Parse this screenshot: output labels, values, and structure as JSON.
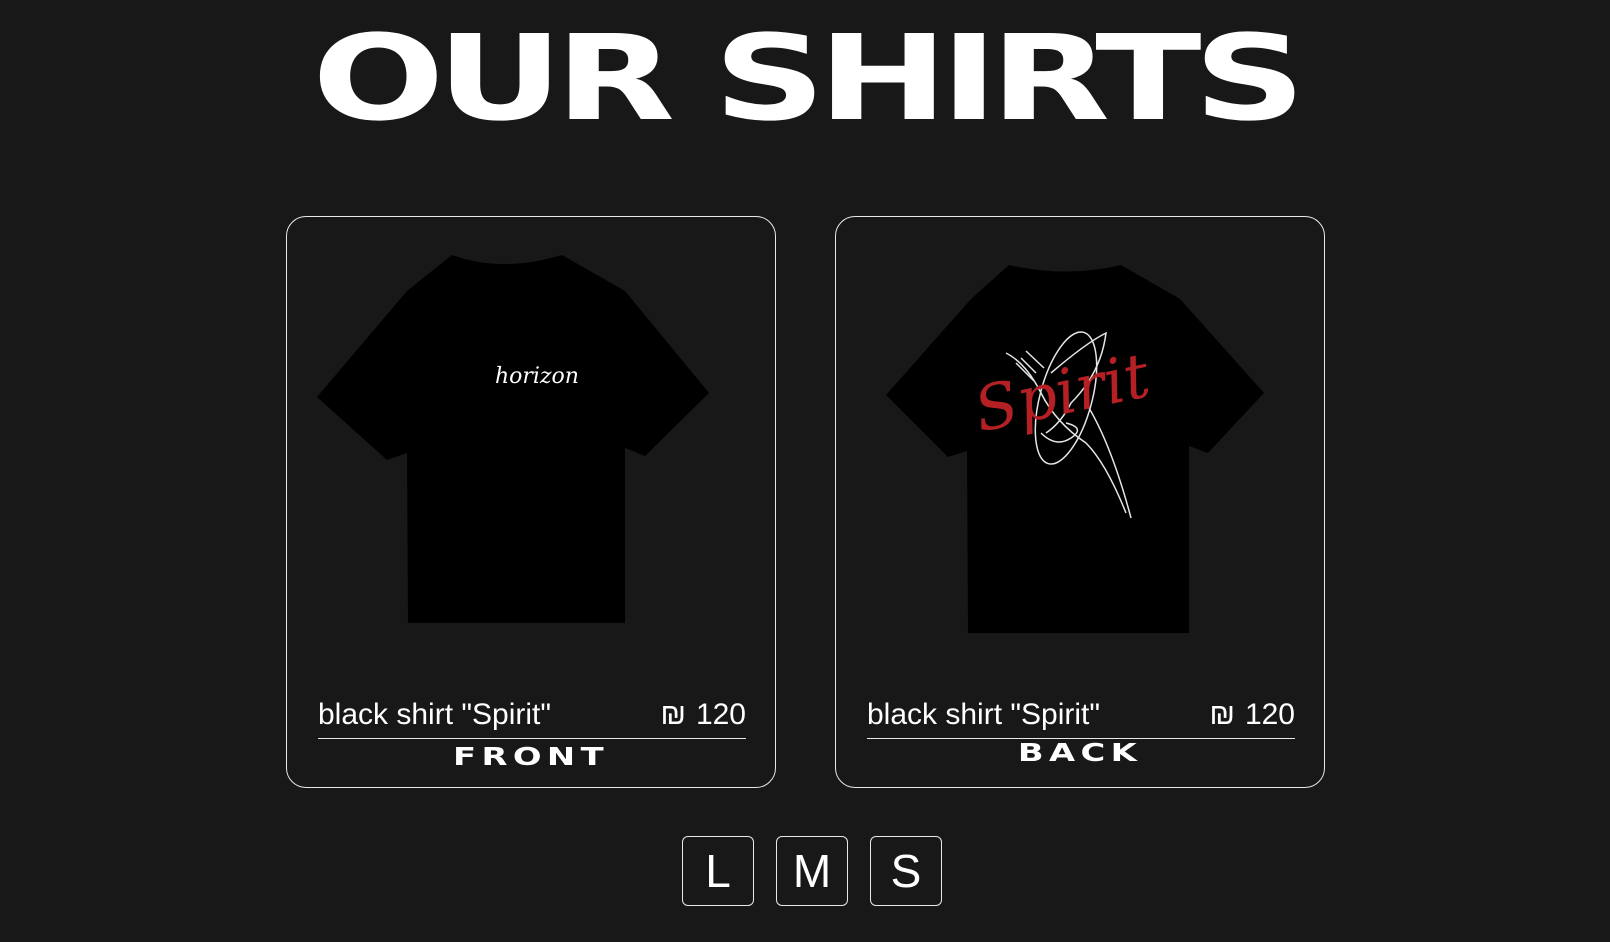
{
  "page": {
    "title": "OUR SHIRTS",
    "background_color": "#181818"
  },
  "products": [
    {
      "name": "black shirt \"Spirit\"",
      "currency_symbol": "₪",
      "price": "120",
      "view_label": "FRONT",
      "print_text": "horizon"
    },
    {
      "name": "black shirt \"Spirit\"",
      "currency_symbol": "₪",
      "price": "120",
      "view_label": "BACK",
      "print_text": "Spirit",
      "print_color": "#b52025"
    }
  ],
  "sizes": [
    "L",
    "M",
    "S"
  ]
}
